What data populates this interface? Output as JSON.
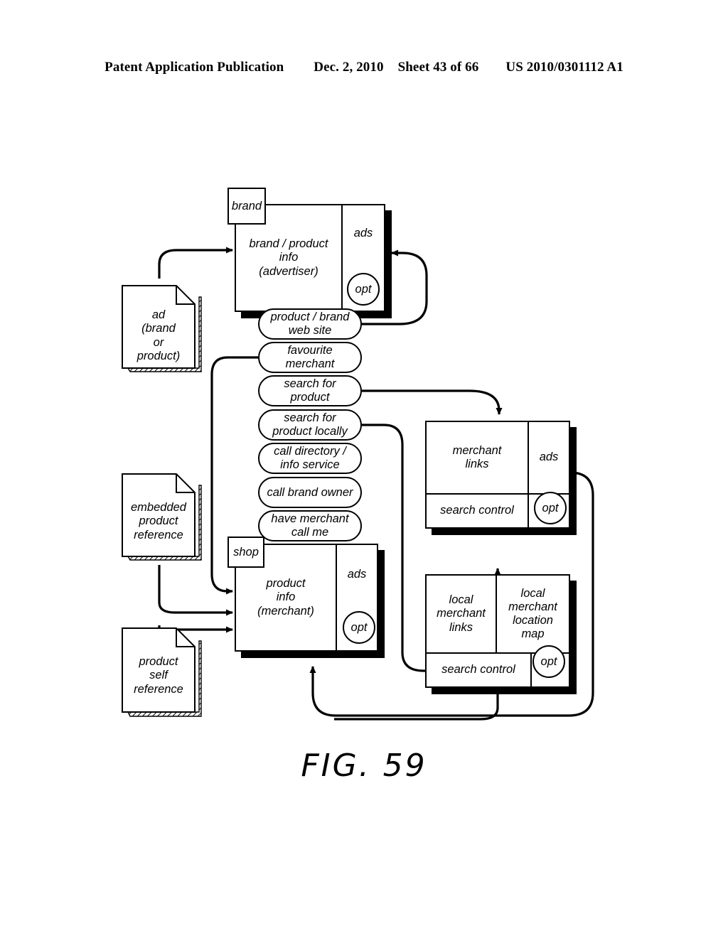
{
  "header": {
    "publication": "Patent Application Publication",
    "date": "Dec. 2, 2010",
    "sheet": "Sheet 43 of 66",
    "number": "US 2010/0301112 A1"
  },
  "figure": {
    "caption": "FIG. 59"
  },
  "screens": {
    "advertiser": {
      "tab": "brand",
      "main": "brand / product\ninfo\n(advertiser)",
      "ads": "ads",
      "opt": "opt"
    },
    "merchant_product": {
      "tab": "shop",
      "main": "product\ninfo\n(merchant)",
      "ads": "ads",
      "opt": "opt"
    },
    "merchant_links": {
      "main": "merchant\nlinks",
      "ads": "ads",
      "search_control": "search control",
      "opt": "opt"
    },
    "local_merchant": {
      "links": "local\nmerchant\nlinks",
      "map": "local\nmerchant\nlocation\nmap",
      "search_control": "search control",
      "opt": "opt"
    }
  },
  "menu": {
    "items": [
      {
        "label": "product / brand\nweb site"
      },
      {
        "label": "favourite\nmerchant"
      },
      {
        "label": "search for\nproduct"
      },
      {
        "label": "search for\nproduct locally"
      },
      {
        "label": "call directory /\ninfo service"
      },
      {
        "label": "call brand owner"
      },
      {
        "label": "have merchant\ncall me"
      }
    ]
  },
  "documents": [
    {
      "id": "ad",
      "label": "ad\n(brand\nor\nproduct)"
    },
    {
      "id": "embedded",
      "label": "embedded\nproduct\nreference"
    },
    {
      "id": "self",
      "label": "product\nself\nreference"
    }
  ],
  "colors": {
    "ink": "#000000",
    "paper": "#ffffff"
  }
}
